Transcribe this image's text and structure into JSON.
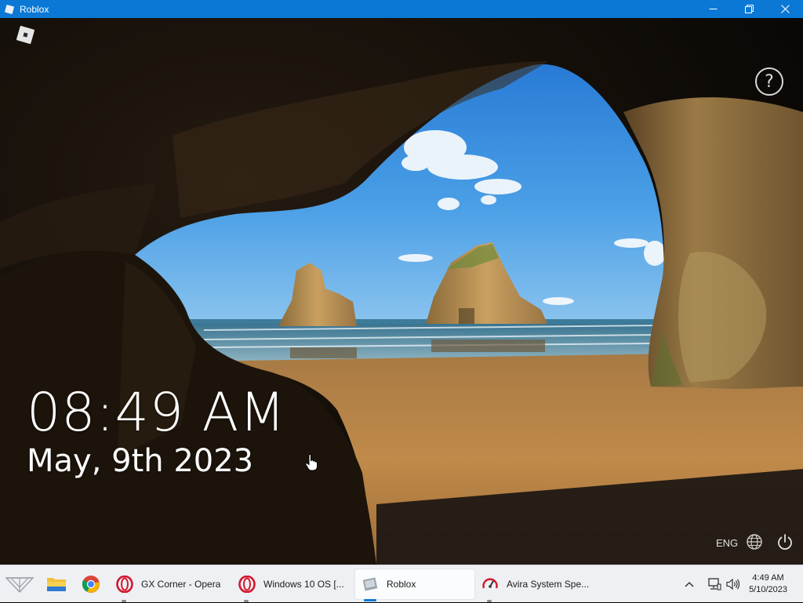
{
  "window": {
    "title": "Roblox",
    "controls": [
      "minimize",
      "maximize",
      "close"
    ]
  },
  "lockscreen": {
    "time": "08:49 AM",
    "date": "May, 9th 2023",
    "language": "ENG",
    "icons": [
      "roblox-logo",
      "help-icon",
      "globe-icon",
      "power-icon"
    ]
  },
  "taskbar": {
    "pinned": [
      "start-icon",
      "file-explorer-icon",
      "chrome-icon"
    ],
    "apps": [
      {
        "label": "GX Corner - Opera",
        "icon": "opera-icon",
        "active": false
      },
      {
        "label": "Windows 10 OS [...",
        "icon": "opera-icon",
        "active": false
      },
      {
        "label": "Roblox",
        "icon": "roblox-icon",
        "active": true
      },
      {
        "label": "Avira System Spe...",
        "icon": "avira-speedometer-icon",
        "active": false
      }
    ],
    "tray": {
      "time": "4:49 AM",
      "date": "5/10/2023",
      "icons": [
        "chevron-up-icon",
        "network-icon",
        "volume-icon"
      ]
    }
  },
  "colors": {
    "titlebar": "#0a78d4",
    "taskbar": "#eef0f3",
    "accent": "#0a78d4",
    "opera_red": "#d3172f"
  }
}
